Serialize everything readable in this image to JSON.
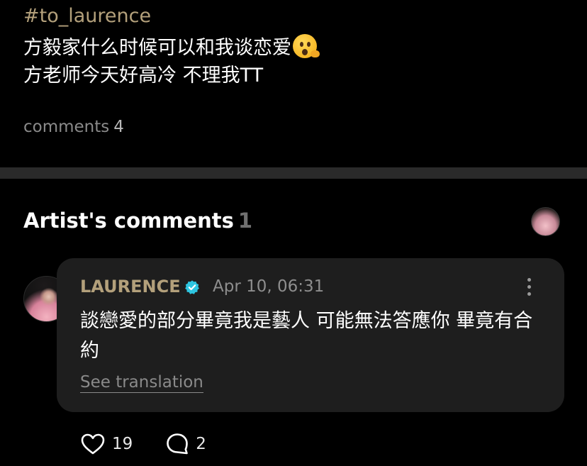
{
  "post": {
    "hashtag": "#to_laurence",
    "line1": "方毅家什么时候可以和我谈恋爱",
    "line2": "方老师今天好高冷 不理我TT",
    "comments_label": "comments",
    "comments_count": "4"
  },
  "artist_section": {
    "title": "Artist's comments",
    "count": "1"
  },
  "comment": {
    "author": "LAURENCE",
    "timestamp": "Apr 10, 06:31",
    "body": "談戀愛的部分畢竟我是藝人 可能無法答應你 畢竟有合約",
    "see_translation": "See translation",
    "likes": "19",
    "replies": "2"
  },
  "colors": {
    "background": "#000000",
    "accent_gold": "#b3a07b",
    "card": "#1e1e1e",
    "divider": "#2a2a2a",
    "verified": "#2ec5e0"
  },
  "icons": {
    "emoji": "hushed-face-with-hand",
    "verified": "verified-badge-icon",
    "more": "more-vertical-icon",
    "like": "heart-icon",
    "reply": "speech-bubble-icon"
  }
}
